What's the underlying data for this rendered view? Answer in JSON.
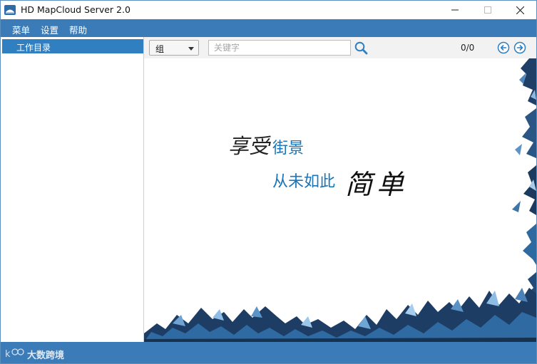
{
  "window": {
    "title": "HD MapCloud Server 2.0"
  },
  "menu": {
    "items": [
      "菜单",
      "设置",
      "帮助"
    ]
  },
  "sidebar": {
    "selected_item": "工作目录"
  },
  "toolbar": {
    "group_value": "组",
    "search_placeholder": "关键字",
    "search_value": "",
    "counter": "0/0"
  },
  "banner": {
    "line1_script": "享受",
    "line1_highlight": "街景",
    "line2_highlight": "从未如此",
    "line2_script": "简单"
  },
  "status": {
    "brand_text": "大数跨境"
  },
  "colors": {
    "accent": "#3b7bb8",
    "selected": "#2f7fc1",
    "highlight_text": "#1a76b8"
  }
}
